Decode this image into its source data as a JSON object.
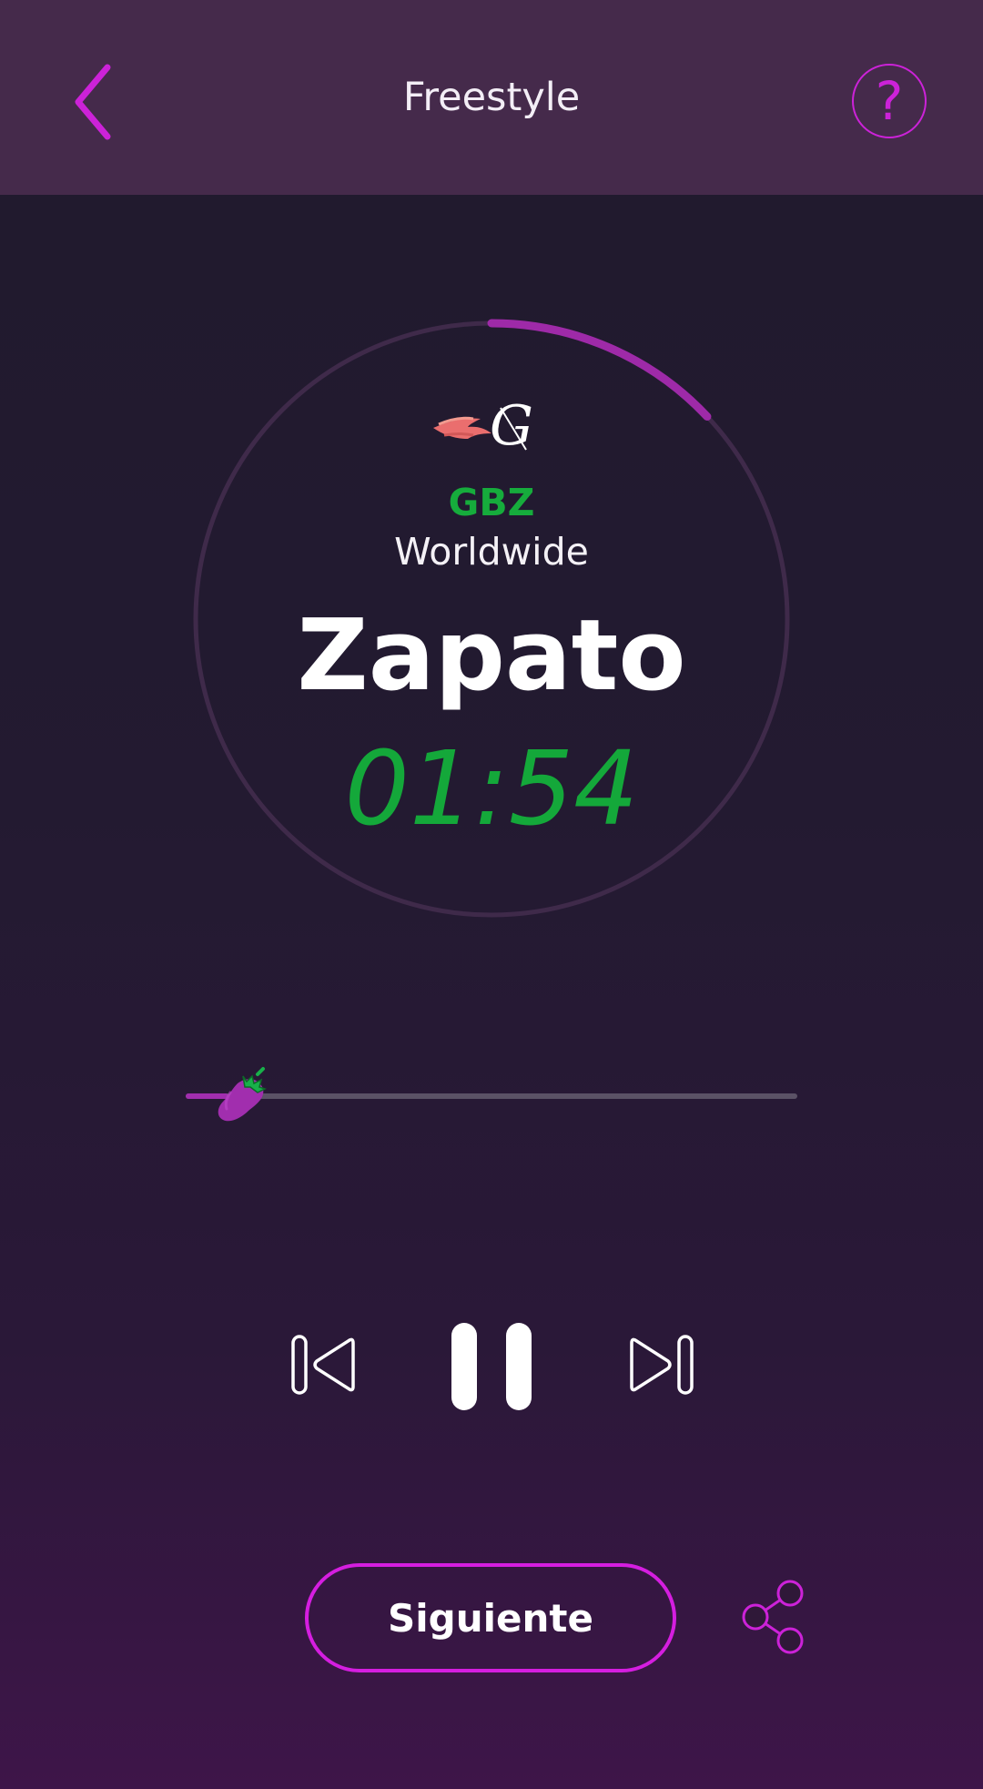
{
  "header": {
    "title": "Freestyle",
    "back_icon": "chevron-left-icon",
    "help_icon": "question-mark-icon",
    "help_glyph": "?"
  },
  "colors": {
    "accent": "#cc22d8",
    "green": "#16ac3c",
    "header_bg": "#452a4b",
    "background": "#221a2e"
  },
  "card": {
    "logo_icon": "flame-g-logo-icon",
    "artist": "GBZ",
    "region": "Worldwide",
    "word": "Zapato",
    "timer": "01:54",
    "ring_progress": 0.13
  },
  "seek": {
    "progress": 0.07,
    "thumb_icon": "eggplant-icon"
  },
  "controls": {
    "previous_icon": "skip-previous-icon",
    "pause_icon": "pause-icon",
    "next_icon": "skip-next-icon"
  },
  "footer": {
    "next_label": "Siguiente",
    "share_icon": "share-icon"
  }
}
